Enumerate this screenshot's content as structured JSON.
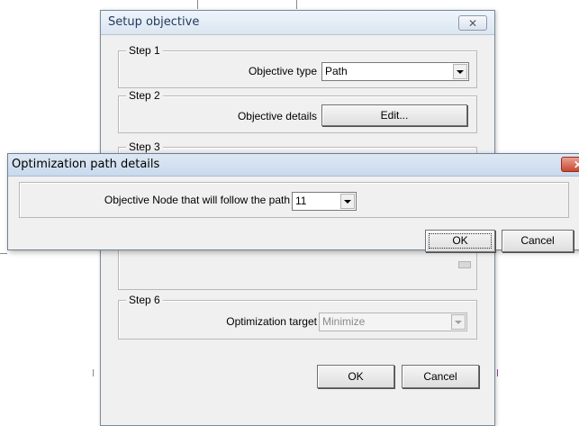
{
  "setup_dialog": {
    "title": "Setup objective",
    "close_symbol": "✕",
    "step1": {
      "legend": "Step 1",
      "label": "Objective type",
      "value": "Path"
    },
    "step2": {
      "legend": "Step 2",
      "label": "Objective details",
      "button": "Edit..."
    },
    "step3": {
      "legend": "Step 3"
    },
    "step6": {
      "legend": "Step 6",
      "label": "Optimization target",
      "value": "Minimize"
    },
    "ok": "OK",
    "cancel": "Cancel"
  },
  "path_dialog": {
    "title": "Optimization path details",
    "close_symbol": "✕",
    "label": "Objective Node that will follow the path",
    "node_value": "11",
    "ok": "OK",
    "cancel": "Cancel"
  },
  "colors": {
    "close_red": "#c7482f",
    "title_blue": "#1e395b"
  },
  "icons": {
    "close": "close-icon",
    "dropdown": "chevron-down-icon"
  }
}
